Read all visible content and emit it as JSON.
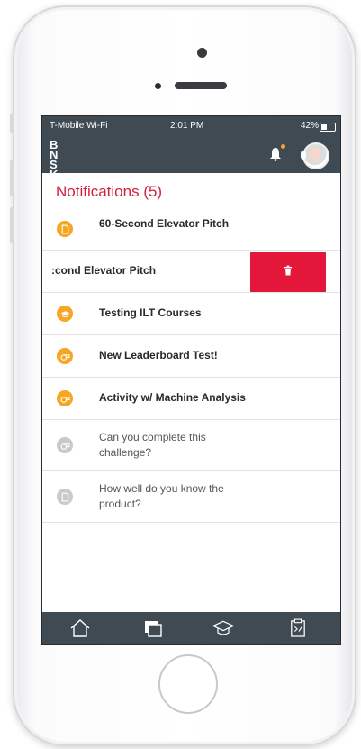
{
  "status": {
    "carrier": "T-Mobile Wi-Fi",
    "time": "2:01 PM",
    "battery": "42%"
  },
  "header": {
    "logo": "BN SK"
  },
  "page": {
    "title": "Notifications (5)"
  },
  "notifications": [
    {
      "label": "60-Second Elevator Pitch",
      "icon": "document-icon",
      "state": "unread"
    },
    {
      "label": ":cond Elevator Pitch",
      "icon": "document-icon",
      "state": "swiped"
    },
    {
      "label": "Testing ILT Courses",
      "icon": "graduation-cap-icon",
      "state": "unread"
    },
    {
      "label": "New Leaderboard Test!",
      "icon": "whistle-icon",
      "state": "unread"
    },
    {
      "label": "Activity w/ Machine Analysis",
      "icon": "whistle-icon",
      "state": "unread"
    },
    {
      "label": "Can you complete this challenge?",
      "icon": "whistle-icon",
      "state": "read"
    },
    {
      "label": "How well do you know the product?",
      "icon": "document-icon",
      "state": "read"
    }
  ],
  "colors": {
    "accent": "#d31f3c",
    "bar": "#3f4a52",
    "badge_orange": "#f5a623",
    "badge_grey": "#c9c9c9",
    "delete": "#e3173a"
  },
  "tabs": [
    "home-icon",
    "library-icon",
    "graduation-cap-icon",
    "scorecard-icon"
  ]
}
